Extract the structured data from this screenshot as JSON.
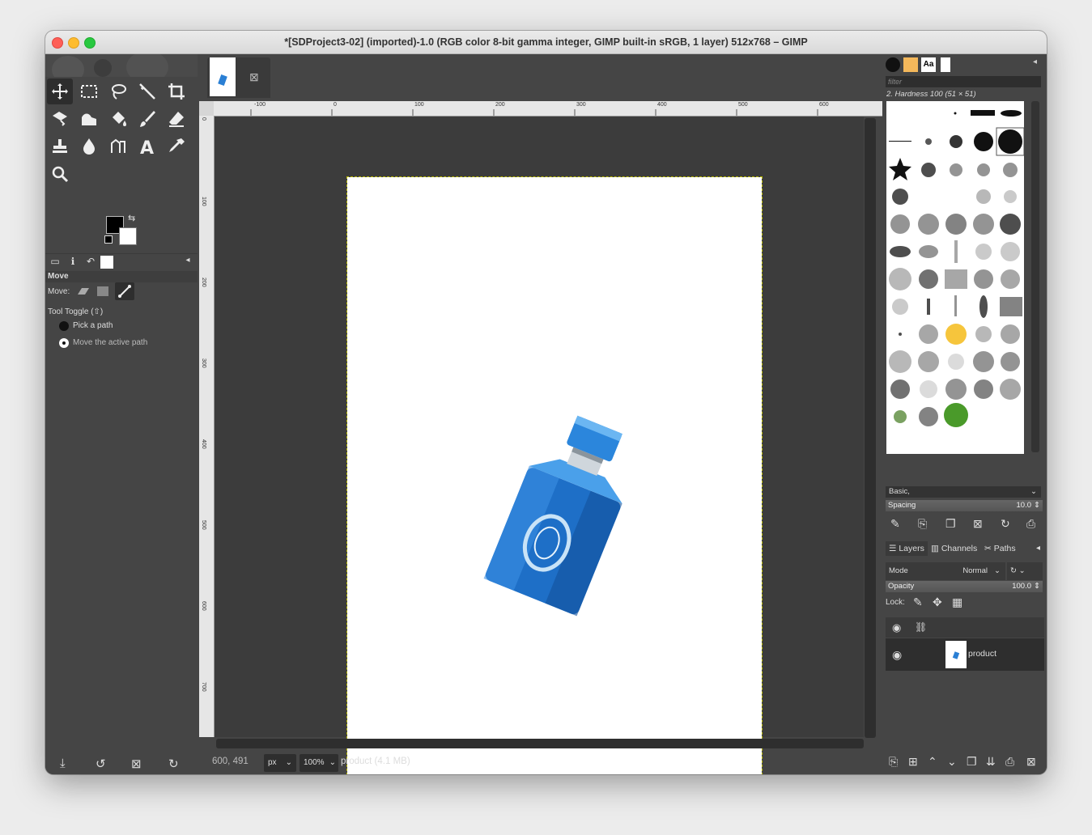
{
  "window": {
    "title": "*[SDProject3-02] (imported)-1.0 (RGB color 8-bit gamma integer, GIMP built-in sRGB, 1 layer) 512x768 – GIMP"
  },
  "tool_options": {
    "header": "Move",
    "move_label": "Move:",
    "tool_toggle": "Tool Toggle  (⇧)",
    "options": [
      "Pick a path",
      "Move the active path"
    ]
  },
  "canvas": {
    "ruler_h_labels": [
      "-100",
      "0",
      "100",
      "200",
      "300",
      "400",
      "500",
      "600"
    ],
    "ruler_v_labels": [
      "0",
      "100",
      "200",
      "300",
      "400",
      "500",
      "600",
      "700"
    ],
    "image_name": "product"
  },
  "status": {
    "coords": "600, 491",
    "unit": "px",
    "zoom": "100%",
    "label": "product (4.1 MB)"
  },
  "brushes": {
    "filter_placeholder": "filter",
    "selected_brush": "2. Hardness 100 (51 × 51)",
    "preset": "Basic,",
    "spacing_label": "Spacing",
    "spacing_value": "10.0"
  },
  "layers": {
    "tabs": [
      "Layers",
      "Channels",
      "Paths"
    ],
    "mode_label": "Mode",
    "mode_value": "Normal",
    "opacity_label": "Opacity",
    "opacity_value": "100.0",
    "lock_label": "Lock:",
    "items": [
      {
        "name": "product"
      }
    ]
  },
  "colors": {
    "accent_fg": "#000000",
    "accent_bg": "#ffffff",
    "product_blue": "#2a7fd4"
  }
}
